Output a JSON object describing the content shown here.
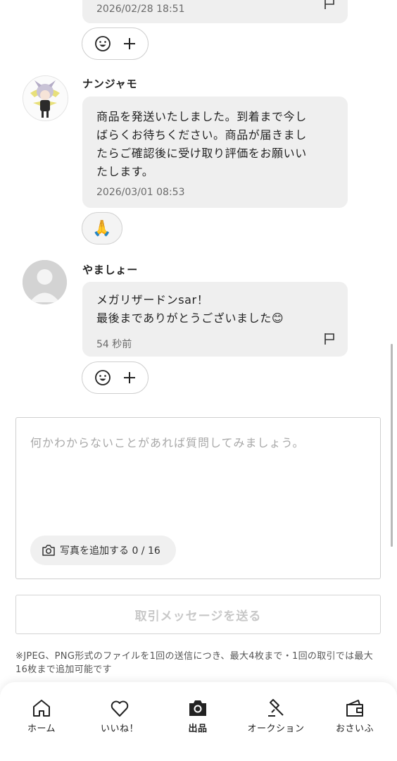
{
  "messages": [
    {
      "time": "2026/02/28 18:51"
    },
    {
      "username": "ナンジャモ",
      "text": "商品を発送いたしました。到着まで今し\nばらくお待ちください。商品が届きまし\nたらご確認後に受け取り評価をお願いい\nたします。",
      "time": "2026/03/01 08:53",
      "reaction": "🙏"
    },
    {
      "username": "やましょー",
      "text": "メガリザードンsar！\n最後までありがとうございました😊",
      "time": "54 秒前"
    }
  ],
  "composer": {
    "placeholder": "何かわからないことがあれば質問してみましょう。",
    "add_photo_label": "写真を追加する 0 / 16",
    "send_label": "取引メッセージを送る",
    "notice": "※JPEG、PNG形式のファイルを1回の送信につき、最大4枚まで・1回の取引では最大16枚まで追加可能です"
  },
  "nav": [
    {
      "label": "ホーム",
      "icon": "home-icon"
    },
    {
      "label": "いいね！",
      "icon": "heart-icon"
    },
    {
      "label": "出品",
      "icon": "camera-icon"
    },
    {
      "label": "オークション",
      "icon": "gavel-icon"
    },
    {
      "label": "おさいふ",
      "icon": "wallet-icon"
    }
  ],
  "colors": {
    "bubble": "#efefef",
    "accent_text": "#222222",
    "muted": "#a8a8a8"
  }
}
